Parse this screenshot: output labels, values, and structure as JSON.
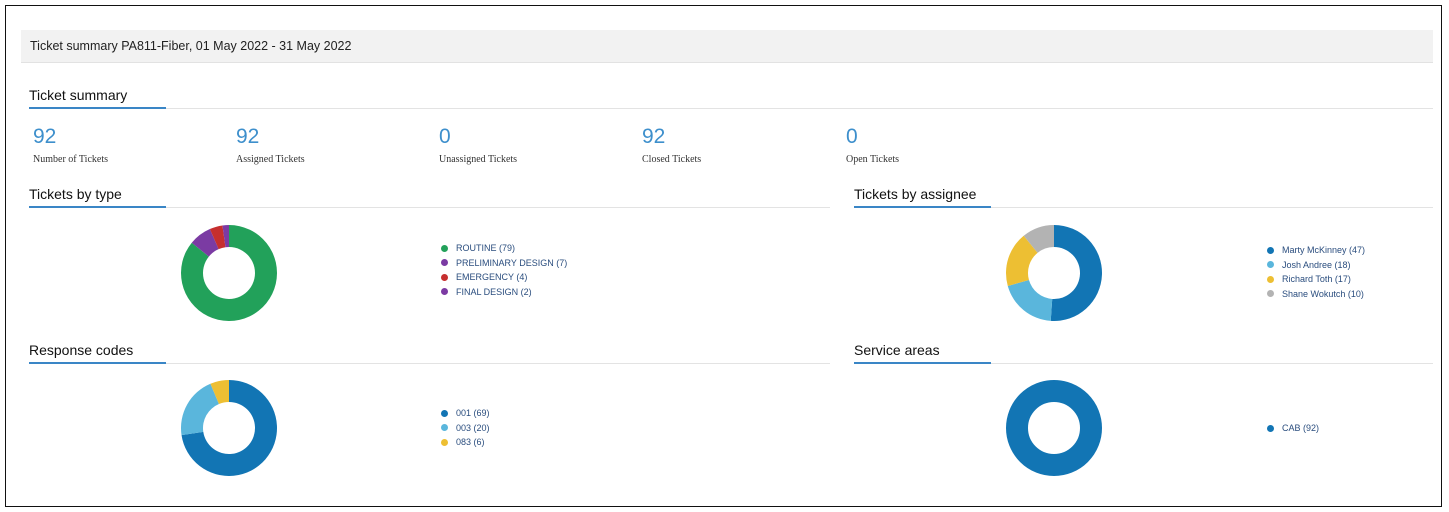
{
  "header": {
    "title": "Ticket summary PA811-Fiber, 01 May 2022 - 31 May 2022"
  },
  "ticket_summary": {
    "title": "Ticket summary",
    "stats": [
      {
        "value": "92",
        "label": "Number of Tickets"
      },
      {
        "value": "92",
        "label": "Assigned Tickets"
      },
      {
        "value": "0",
        "label": "Unassigned Tickets"
      },
      {
        "value": "92",
        "label": "Closed Tickets"
      },
      {
        "value": "0",
        "label": "Open Tickets"
      }
    ]
  },
  "tickets_by_type": {
    "title": "Tickets by type",
    "items": [
      {
        "label": "ROUTINE (79)",
        "value": 79,
        "color": "#22a15a"
      },
      {
        "label": "PRELIMINARY DESIGN (7)",
        "value": 7,
        "color": "#7b3ba3"
      },
      {
        "label": "EMERGENCY (4)",
        "value": 4,
        "color": "#c62f2f"
      },
      {
        "label": "FINAL DESIGN (2)",
        "value": 2,
        "color": "#7c3aa3"
      }
    ]
  },
  "tickets_by_assignee": {
    "title": "Tickets by assignee",
    "items": [
      {
        "label": "Marty McKinney (47)",
        "value": 47,
        "color": "#1275b4"
      },
      {
        "label": "Josh Andree (18)",
        "value": 18,
        "color": "#5ab6dc"
      },
      {
        "label": "Richard Toth (17)",
        "value": 17,
        "color": "#edbf33"
      },
      {
        "label": "Shane Wokutch (10)",
        "value": 10,
        "color": "#b3b3b3"
      }
    ]
  },
  "response_codes": {
    "title": "Response codes",
    "items": [
      {
        "label": "001 (69)",
        "value": 69,
        "color": "#1275b4"
      },
      {
        "label": "003 (20)",
        "value": 20,
        "color": "#5ab6dc"
      },
      {
        "label": "083 (6)",
        "value": 6,
        "color": "#edbf33"
      }
    ]
  },
  "service_areas": {
    "title": "Service areas",
    "items": [
      {
        "label": "CAB (92)",
        "value": 92,
        "color": "#1275b4"
      }
    ]
  }
}
